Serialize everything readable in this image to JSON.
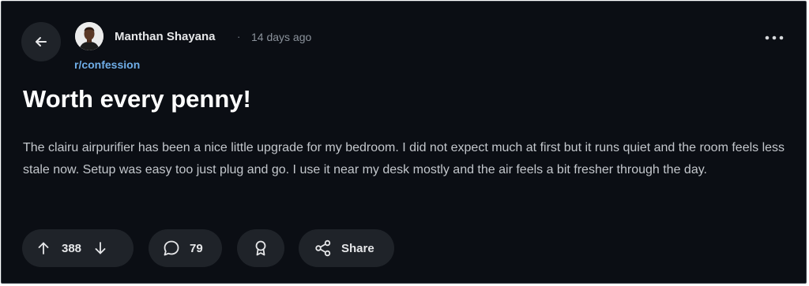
{
  "post": {
    "author": "Manthan Shayana",
    "separator": "·",
    "time": "14 days ago",
    "subreddit": "r/confession",
    "title": "Worth every penny!",
    "body": "The clairu airpurifier has been a nice little upgrade for my bedroom. I did not expect much at first but it runs quiet and the room feels less stale now. Setup was easy too just plug and go. I use it near my desk mostly and the air feels a bit fresher through the day."
  },
  "actions": {
    "votes": "388",
    "comments": "79",
    "share_label": "Share"
  },
  "icons": {
    "back": "arrow-left-icon",
    "more": "more-horizontal-icon",
    "upvote": "arrow-up-icon",
    "downvote": "arrow-down-icon",
    "comment": "speech-bubble-icon",
    "award": "award-ribbon-icon",
    "share": "share-nodes-icon"
  },
  "colors": {
    "background": "#0b0e14",
    "pill": "#1f2329",
    "subreddit_link": "#6faee8",
    "text": "#e6e7e9"
  }
}
